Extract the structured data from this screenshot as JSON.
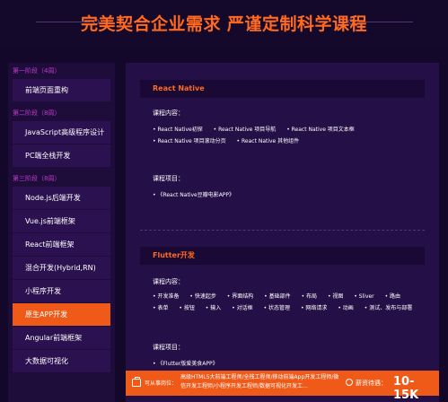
{
  "header": {
    "title": "完美契合企业需求 严谨定制科学课程"
  },
  "sidebar": {
    "stages": [
      {
        "label": "第一阶段（4周）",
        "items": [
          "前端页面重构"
        ]
      },
      {
        "label": "第二阶段（8周）",
        "items": [
          "JavaScript高级程序设计",
          "PC端全栈开发"
        ]
      },
      {
        "label": "第三阶段（8周）",
        "items": [
          "Node.js后端开发",
          "Vue.js前端框架",
          "React前端框架",
          "混合开发(Hybrid,RN)",
          "小程序开发",
          "原生APP开发",
          "Angular前端框架",
          "大数据可视化"
        ]
      }
    ],
    "active_item": "原生APP开发"
  },
  "sections": [
    {
      "title": "React Native",
      "content_label": "课程内容：",
      "tags": [
        "React Native初探",
        "React Native 项目导航",
        "React Native 项目文本框",
        "React Native 项目滚动分页",
        "React Native 其他组件"
      ],
      "project_label": "课程项目：",
      "project": "《React Native豆瓣电影APP》"
    },
    {
      "title": "Flutter开发",
      "content_label": "课程内容：",
      "tags": [
        "开发准备",
        "快速起步",
        "界面结构",
        "基础部件",
        "布局",
        "视图",
        "Sliver",
        "路由",
        "表单",
        "按钮",
        "输入",
        "对话框",
        "状态管理",
        "网络请求",
        "动画",
        "测试、发布与部署"
      ],
      "project_label": "课程项目：",
      "project": "《Flutter版爱美食APP》"
    }
  ],
  "footer": {
    "jobs_label": "可从事岗位：",
    "jobs": "高级HTML5大前端工程师/全栈工程师/移动前端App开发工程师/微信开发工程师/小程序开发工程师/数据可视化开发工...",
    "salary_label": "薪资待遇：",
    "salary": "10-15K"
  }
}
